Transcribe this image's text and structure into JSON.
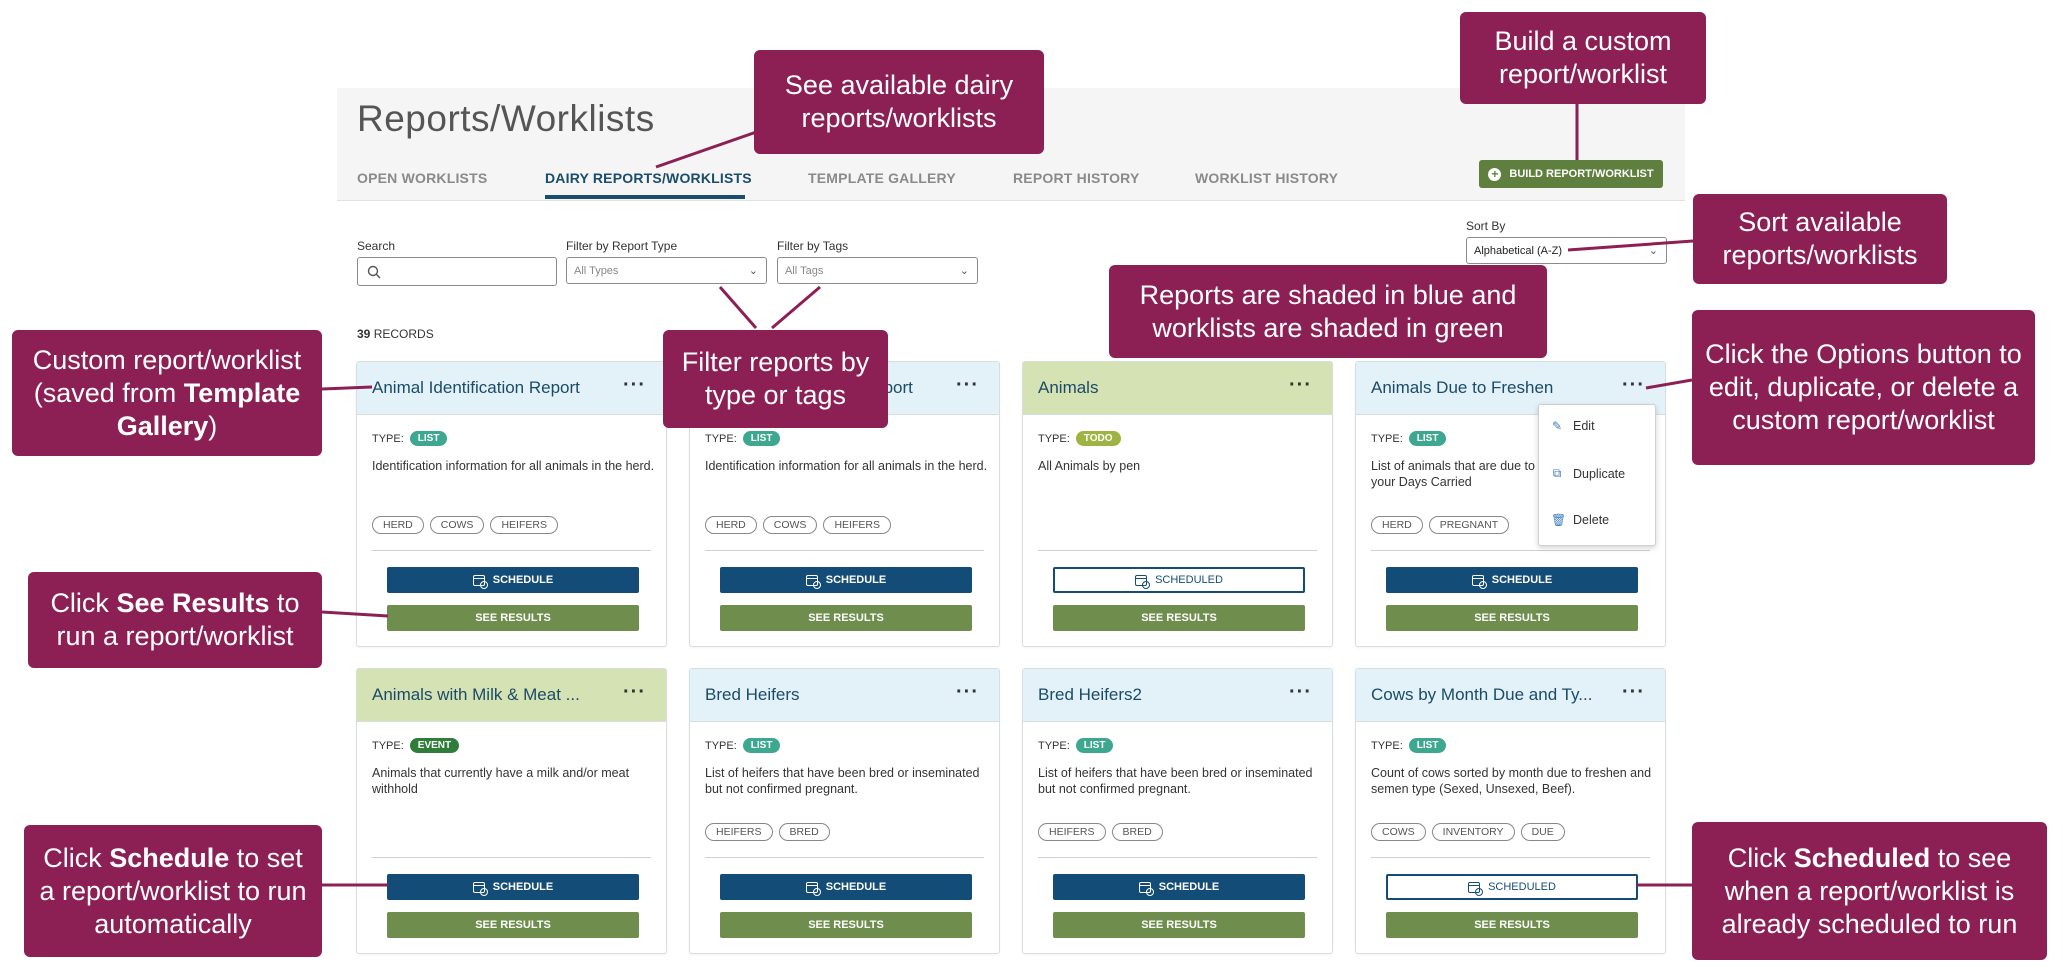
{
  "page": {
    "title": "Reports/Worklists",
    "tabs": [
      {
        "label": "OPEN WORKLISTS"
      },
      {
        "label": "DAIRY REPORTS/WORKLISTS",
        "active": true
      },
      {
        "label": "TEMPLATE GALLERY"
      },
      {
        "label": "REPORT HISTORY"
      },
      {
        "label": "WORKLIST HISTORY"
      }
    ],
    "build_button": "BUILD REPORT/WORKLIST",
    "filters": {
      "search_label": "Search",
      "search_value": "",
      "report_type_label": "Filter by Report Type",
      "report_type_value": "All Types",
      "tags_label": "Filter by Tags",
      "tags_value": "All Tags",
      "sort_label": "Sort By",
      "sort_value": "Alphabetical (A-Z)"
    },
    "records_count": "39",
    "records_label": "RECORDS"
  },
  "cards": [
    {
      "title": "Animal Identification Report",
      "kind": "report",
      "type_label": "TYPE:",
      "type": "LIST",
      "description": "Identification information for all animals in the herd.",
      "tags": [
        "HERD",
        "COWS",
        "HEIFERS"
      ],
      "schedule": "SCHEDULE",
      "results": "SEE RESULTS"
    },
    {
      "title": "Animal Identification Report",
      "kind": "report",
      "type_label": "TYPE:",
      "type": "LIST",
      "description": "Identification information for all animals in the herd.",
      "tags": [
        "HERD",
        "COWS",
        "HEIFERS"
      ],
      "schedule": "SCHEDULE",
      "results": "SEE RESULTS"
    },
    {
      "title": "Animals",
      "kind": "worklist",
      "type_label": "TYPE:",
      "type": "TODO",
      "description": "All Animals by pen",
      "tags": [],
      "schedule": "SCHEDULED",
      "results": "SEE RESULTS"
    },
    {
      "title": "Animals Due to Freshen",
      "kind": "report",
      "type_label": "TYPE:",
      "type": "LIST",
      "description": "List of animals that are due to freshen based on your Days Carried",
      "tags": [
        "HERD",
        "PREGNANT"
      ],
      "schedule": "SCHEDULE",
      "results": "SEE RESULTS"
    },
    {
      "title": "Animals with Milk & Meat ...",
      "kind": "worklist",
      "type_label": "TYPE:",
      "type": "EVENT",
      "description": "Animals that currently have a milk and/or meat withhold",
      "tags": [],
      "schedule": "SCHEDULE",
      "results": "SEE RESULTS"
    },
    {
      "title": "Bred Heifers",
      "kind": "report",
      "type_label": "TYPE:",
      "type": "LIST",
      "description": "List of heifers that have been bred or inseminated but not confirmed pregnant.",
      "tags": [
        "HEIFERS",
        "BRED"
      ],
      "schedule": "SCHEDULE",
      "results": "SEE RESULTS"
    },
    {
      "title": "Bred Heifers2",
      "kind": "report",
      "type_label": "TYPE:",
      "type": "LIST",
      "description": "List of heifers that have been bred or inseminated but not confirmed pregnant.",
      "tags": [
        "HEIFERS",
        "BRED"
      ],
      "schedule": "SCHEDULE",
      "results": "SEE RESULTS"
    },
    {
      "title": "Cows by Month Due and Ty...",
      "kind": "report",
      "type_label": "TYPE:",
      "type": "LIST",
      "description": "Count of cows sorted by month due to freshen and semen type (Sexed, Unsexed, Beef).",
      "tags": [
        "COWS",
        "INVENTORY",
        "DUE"
      ],
      "schedule": "SCHEDULED",
      "results": "SEE RESULTS"
    }
  ],
  "options_menu": {
    "edit": "Edit",
    "duplicate": "Duplicate",
    "delete": "Delete"
  },
  "callouts": {
    "build": "Build a custom report/worklist",
    "dairy": "See available dairy reports/worklists",
    "sort": "Sort available reports/worklists",
    "shading": "Reports are shaded in blue and worklists are shaded in green",
    "filter": "Filter reports by type or tags",
    "options": "Click the Options button to edit, duplicate, or delete a custom report/worklist",
    "custom_a": "Custom report/worklist (saved from ",
    "custom_b": "Template Gallery",
    "custom_c": ")",
    "results_a": "Click ",
    "results_b": "See Results",
    "results_c": " to run a report/worklist",
    "schedule_a": "Click ",
    "schedule_b": "Schedule",
    "schedule_c": " to set a report/worklist to run automatically",
    "scheduled_a": "Click ",
    "scheduled_b": "Scheduled",
    "scheduled_c": " to see when a report/worklist is already scheduled to run"
  },
  "colors": {
    "callout": "#8c2054",
    "report_head": "#e3f2f9",
    "worklist_head": "#d5e2b4",
    "schedule": "#134c77",
    "results": "#6f8d4c",
    "build": "#5e7f3d"
  }
}
